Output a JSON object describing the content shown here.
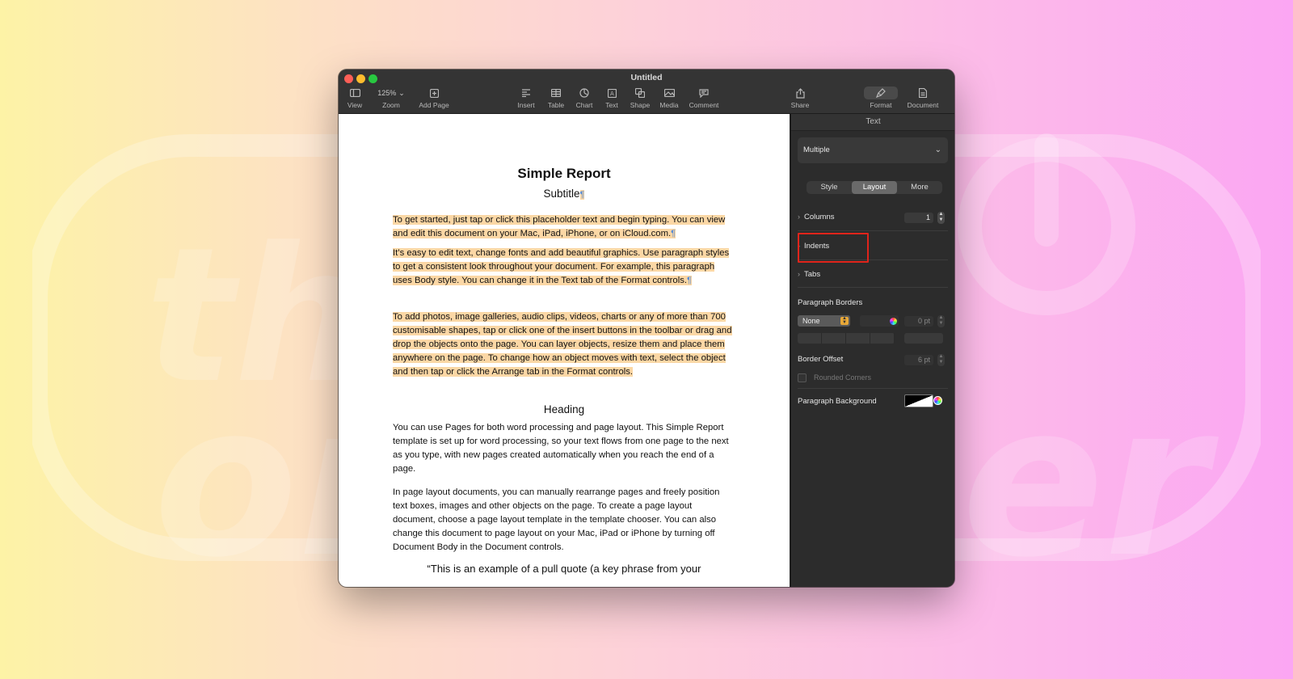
{
  "window": {
    "title": "Untitled"
  },
  "toolbar": {
    "view": "View",
    "zoom_value": "125%",
    "zoom": "Zoom",
    "add_page": "Add Page",
    "insert": "Insert",
    "table": "Table",
    "chart": "Chart",
    "text": "Text",
    "shape": "Shape",
    "media": "Media",
    "comment": "Comment",
    "share": "Share",
    "format": "Format",
    "document": "Document"
  },
  "document": {
    "title": "Simple Report",
    "subtitle": "Subtitle",
    "para1": "To get started, just tap or click this placeholder text and begin typing. You can view and edit this document on your Mac, iPad, iPhone, or on iCloud.com.",
    "para2": "It’s easy to edit text, change fonts and add beautiful graphics. Use paragraph styles to get a consistent look throughout your document. For example, this paragraph uses Body style. You can change it in the Text tab of the Format controls.",
    "para3": "To add photos, image galleries, audio clips, videos, charts or any of more than 700 customisable shapes, tap or click one of the insert buttons in the toolbar or drag and drop the objects onto the page. You can layer objects, resize them and place them anywhere on the page. To change how an object moves with text, select the object and then tap or click the Arrange tab in the Format controls.",
    "heading": "Heading",
    "para4": "You can use Pages for both word processing and page layout. This Simple Report template is set up for word processing, so your text flows from one page to the next as you type, with new pages created automatically when you reach the end of a page.",
    "para5": "In page layout documents, you can manually rearrange pages and freely position text boxes, images and other objects on the page. To create a page layout document, choose a page layout template in the template chooser. You can also change this document to page layout on your Mac, iPad or iPhone by turning off Document Body in the Document controls.",
    "pull_quote": "“This is an example of a pull quote (a key phrase from your",
    "pilcrow": "¶"
  },
  "inspector": {
    "header": "Text",
    "paragraph_style": "Multiple",
    "tabs": [
      "Style",
      "Layout",
      "More"
    ],
    "active_tab": "Layout",
    "columns_label": "Columns",
    "columns_value": "1",
    "indents_label": "Indents",
    "tabs_label": "Tabs",
    "paragraph_borders_label": "Paragraph Borders",
    "border_style": "None",
    "border_width": "0 pt",
    "border_offset_label": "Border Offset",
    "border_offset_value": "6 pt",
    "rounded_corners_label": "Rounded Corners",
    "paragraph_background_label": "Paragraph Background"
  },
  "colors": {
    "selection_highlight": "#fbd7a5",
    "callout_outline": "#e0241b",
    "accent_dropdown": "#e8a838"
  },
  "icons": [
    "view-icon",
    "add-page-icon",
    "insert-icon",
    "table-icon",
    "chart-icon",
    "text-icon",
    "shape-icon",
    "media-icon",
    "comment-icon",
    "share-icon",
    "format-brush-icon",
    "document-icon"
  ]
}
